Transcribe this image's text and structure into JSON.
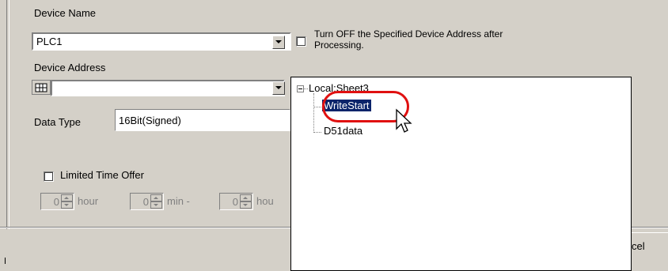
{
  "device_name": {
    "label": "Device Name",
    "value": "PLC1"
  },
  "turn_off": {
    "label_line1": "Turn OFF the Specified Device Address after",
    "label_line2": "Processing."
  },
  "device_address": {
    "label": "Device Address",
    "value": ""
  },
  "data_type": {
    "label": "Data Type",
    "value": "16Bit(Signed)"
  },
  "limited_time": {
    "label": "Limited Time Offer"
  },
  "spinners": [
    {
      "value": "0",
      "unit": "hour"
    },
    {
      "value": "0",
      "unit": "min -"
    },
    {
      "value": "0",
      "unit": "hou"
    }
  ],
  "tree": {
    "root": "Local:Sheet3",
    "items": [
      "WriteStart",
      "D51data"
    ]
  },
  "cancel_button": {
    "label": "cel"
  },
  "colors": {
    "selection": "#0a246a",
    "highlight_circle": "#e01010",
    "dialog": "#d4d0c8"
  }
}
